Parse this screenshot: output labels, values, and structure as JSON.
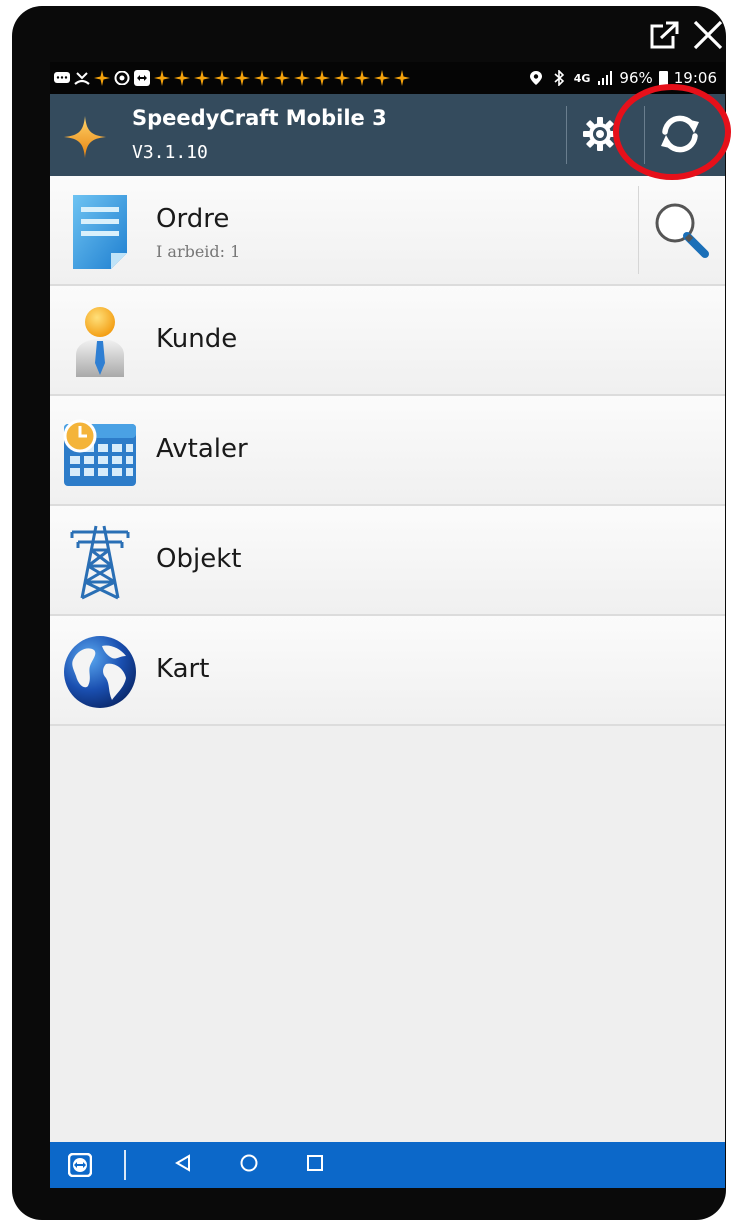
{
  "window_controls": {
    "popout_icon": "popout-icon",
    "close_icon": "close-icon"
  },
  "status_bar": {
    "battery": "96%",
    "time": "19:06",
    "network": "4G",
    "icons": [
      "message-icon",
      "missed-call-icon",
      "star-notification-icon",
      "eye-icon",
      "teamviewer-icon",
      "location-icon",
      "bluetooth-icon",
      "signal-icon",
      "battery-icon"
    ]
  },
  "app_bar": {
    "title": "SpeedyCraft Mobile 3",
    "version": "V3.1.10",
    "logo_icon": "star-logo-icon",
    "settings_icon": "gear-icon",
    "sync_icon": "sync-icon",
    "highlight_color": "#e6101a",
    "background": "#344b5d"
  },
  "menu": {
    "items": [
      {
        "label": "Ordre",
        "sublabel": "I arbeid: 1",
        "icon": "document-icon"
      },
      {
        "label": "Kunde",
        "icon": "person-icon"
      },
      {
        "label": "Avtaler",
        "icon": "calendar-icon"
      },
      {
        "label": "Objekt",
        "icon": "power-tower-icon"
      },
      {
        "label": "Kart",
        "icon": "globe-icon"
      }
    ],
    "search_icon": "search-icon"
  },
  "nav_bar": {
    "background": "#0c68c9",
    "icons": [
      "teamviewer-icon",
      "back-icon",
      "home-icon",
      "recents-icon"
    ]
  }
}
